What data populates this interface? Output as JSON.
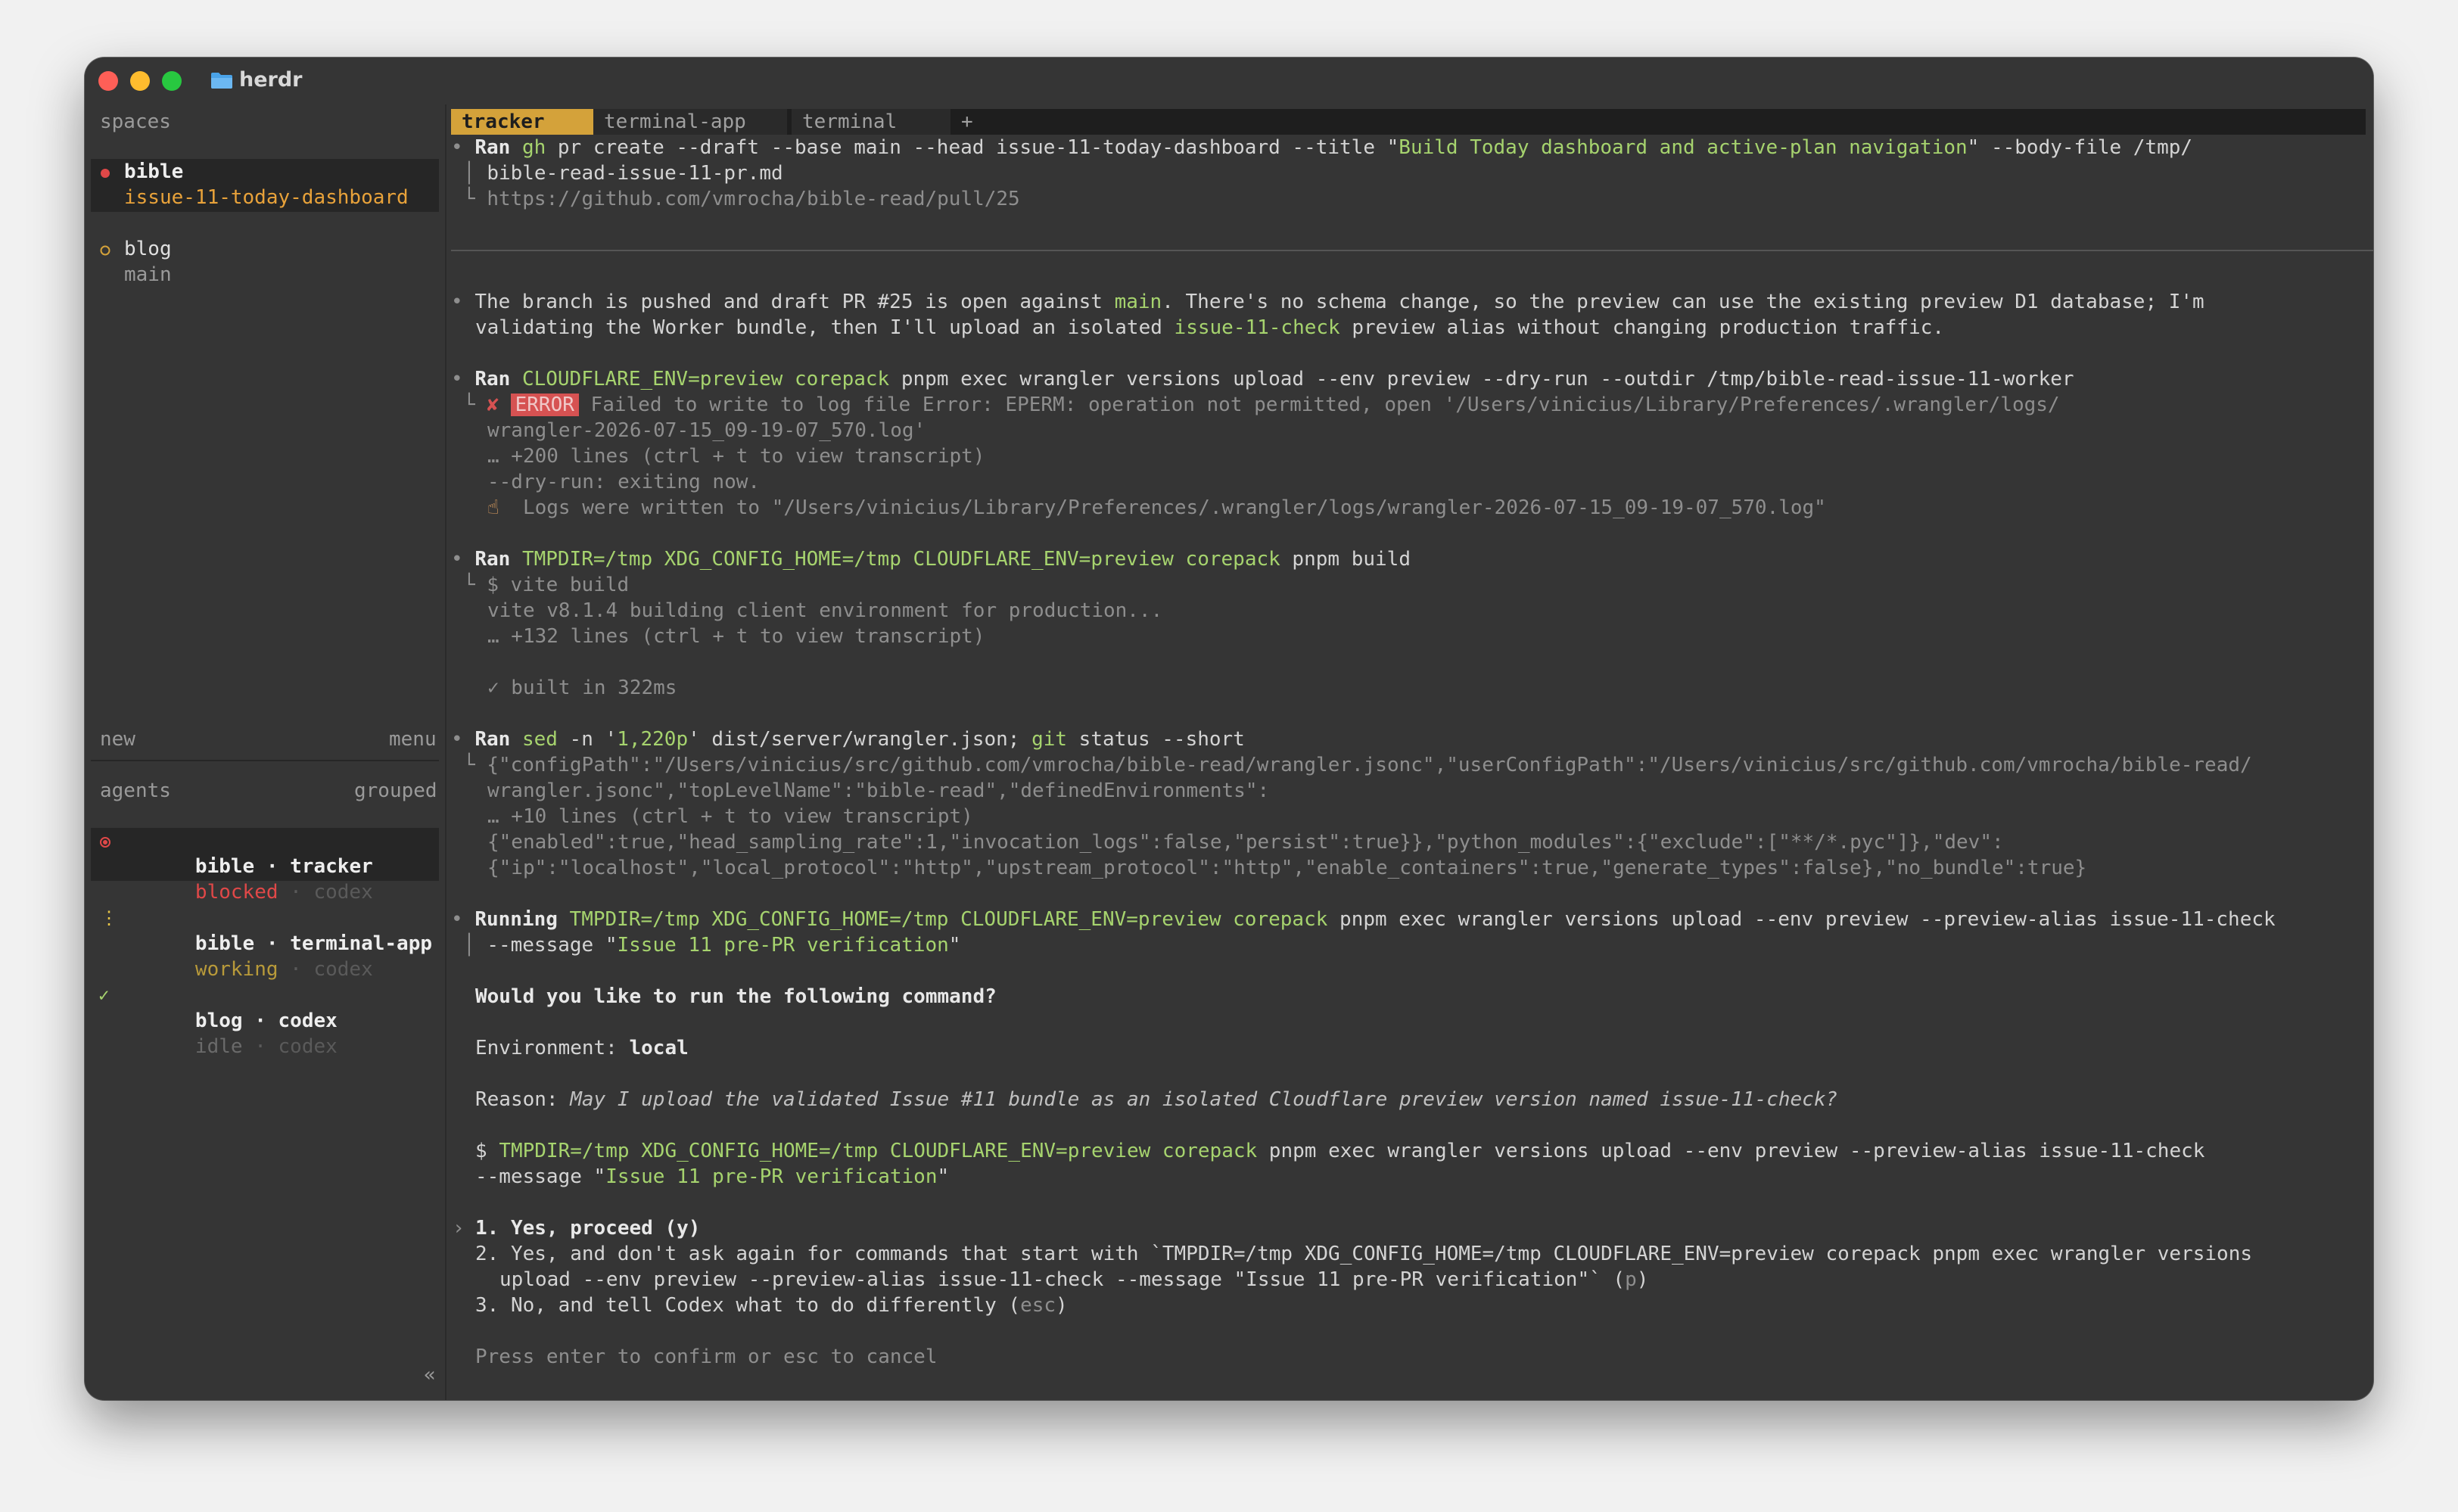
{
  "window": {
    "title": "herdr"
  },
  "sidebar": {
    "spaces_header": "spaces",
    "spaces": [
      {
        "name": "bible",
        "branch": "issue-11-today-dashboard",
        "status": "active"
      },
      {
        "name": "blog",
        "branch": "main",
        "status": "idle"
      }
    ],
    "new_label": "new",
    "menu_label": "menu",
    "agents_header": "agents",
    "grouped_label": "grouped",
    "agents": [
      {
        "space": "bible",
        "separator": " · ",
        "name": "tracker",
        "state": "blocked",
        "tool": "codex"
      },
      {
        "space": "bible",
        "separator": " · ",
        "name": "terminal-app",
        "state": "working",
        "tool": "codex"
      },
      {
        "space": "blog",
        "separator": " · ",
        "name": "codex",
        "state": "idle",
        "tool": "codex"
      }
    ],
    "collapse_label": "«"
  },
  "tabs": [
    {
      "label": "tracker",
      "active": true
    },
    {
      "label": "terminal-app",
      "active": false
    },
    {
      "label": "terminal",
      "active": false
    }
  ],
  "new_tab_label": "+",
  "transcript": {
    "pr": {
      "ran": "Ran",
      "tool": "gh",
      "cmd_a": " pr create --draft --base main --head issue-11-today-dashboard --title \"",
      "title_arg": "Build Today dashboard and active-plan navigation",
      "cmd_b": "\" --body-file /tmp/",
      "cont": "bible-read-issue-11-pr.md",
      "url": "https://github.com/vmrocha/bible-read/pull/25"
    },
    "note": {
      "line1_a": "The branch is pushed and draft PR #25 is open against ",
      "line1_b": "main",
      "line1_c": ". There's no schema change, so the preview can use the existing preview D1 database; I'm",
      "line2_a": "validating the Worker bundle, then I'll upload an isolated ",
      "line2_b": "issue-11-check",
      "line2_c": " preview alias without changing production traffic."
    },
    "dryrun": {
      "ran": "Ran",
      "env": "CLOUDFLARE_ENV=preview",
      "corepack": "corepack",
      "rest": " pnpm exec wrangler versions upload --env preview --dry-run --outdir /tmp/bible-read-issue-11-worker",
      "error_badge": "ERROR",
      "error_text": " Failed to write to log file Error: EPERM: operation not permitted, open '/Users/vinicius/Library/Preferences/.wrangler/logs/",
      "error_cont": "wrangler-2026-07-15_09-19-07_570.log'",
      "more": "… +200 lines (ctrl + t to view transcript)",
      "exiting": "--dry-run: exiting now.",
      "logs": "Logs were written to \"/Users/vinicius/Library/Preferences/.wrangler/logs/wrangler-2026-07-15_09-19-07_570.log\""
    },
    "build": {
      "ran": "Ran",
      "env1": "TMPDIR=/tmp",
      "env2": "XDG_CONFIG_HOME=/tmp",
      "env3": "CLOUDFLARE_ENV=preview",
      "corepack": "corepack",
      "rest": " pnpm build",
      "out1": "$ vite build",
      "out2": "vite v8.1.4 building client environment for production...",
      "out3": "… +132 lines (ctrl + t to view transcript)",
      "out4": "✓ built in 322ms"
    },
    "sed": {
      "ran": "Ran",
      "sed": "sed",
      "args_a": " -n '",
      "range": "1,220p",
      "args_b": "' dist/server/wrangler.json; ",
      "git": "git",
      "args_c": " status --short",
      "out1": "{\"configPath\":\"/Users/vinicius/src/github.com/vmrocha/bible-read/wrangler.jsonc\",\"userConfigPath\":\"/Users/vinicius/src/github.com/vmrocha/bible-read/",
      "out2": "wrangler.jsonc\",\"topLevelName\":\"bible-read\",\"definedEnvironments\":",
      "out3": "… +10 lines (ctrl + t to view transcript)",
      "out4": "{\"enabled\":true,\"head_sampling_rate\":1,\"invocation_logs\":false,\"persist\":true}},\"python_modules\":{\"exclude\":[\"**/*.pyc\"]},\"dev\":",
      "out5": "{\"ip\":\"localhost\",\"local_protocol\":\"http\",\"upstream_protocol\":\"http\",\"enable_containers\":true,\"generate_types\":false},\"no_bundle\":true}"
    },
    "running": {
      "label": "Running",
      "env1": "TMPDIR=/tmp",
      "env2": "XDG_CONFIG_HOME=/tmp",
      "env3": "CLOUDFLARE_ENV=preview",
      "corepack": "corepack",
      "rest": " pnpm exec wrangler versions upload --env preview --preview-alias issue-11-check",
      "cont_a": "--message \"",
      "message": "Issue 11 pre-PR verification",
      "cont_b": "\""
    }
  },
  "prompt": {
    "question": "Would you like to run the following command?",
    "env_label": "Environment: ",
    "env_value": "local",
    "reason_label": "Reason: ",
    "reason_text": "May I upload the validated Issue #11 bundle as an isolated Cloudflare preview version named issue-11-check?",
    "cmd_prefix": "$ ",
    "env1": "TMPDIR=/tmp",
    "env2": "XDG_CONFIG_HOME=/tmp",
    "env3": "CLOUDFLARE_ENV=preview",
    "corepack": "corepack",
    "cmd_rest": " pnpm exec wrangler versions upload --env preview --preview-alias issue-11-check",
    "cmd_cont_a": "--message \"",
    "cmd_msg": "Issue 11 pre-PR verification",
    "cmd_cont_b": "\"",
    "selector": "›",
    "option1": "1. Yes, proceed (y)",
    "option2_line1": "2. Yes, and don't ask again for commands that start with `TMPDIR=/tmp XDG_CONFIG_HOME=/tmp CLOUDFLARE_ENV=preview corepack pnpm exec wrangler versions",
    "option2_line2": "upload --env preview --preview-alias issue-11-check --message \"Issue 11 pre-PR verification\"` (",
    "option2_key": "p",
    "option2_close": ")",
    "option3": "3. No, and tell Codex what to do differently (",
    "option3_key": "esc",
    "option3_close": ")",
    "footer": "Press enter to confirm or esc to cancel"
  },
  "colors": {
    "accent_tab": "#d4a23a",
    "command_green": "#a6d36e",
    "error_red": "#d65252",
    "blocked_red": "#e04848",
    "working_yellow": "#e8c547"
  },
  "icons": [
    "folder-icon",
    "status-dot-icon",
    "status-ring-icon",
    "blocked-icon",
    "spinner-icon",
    "check-icon",
    "error-x-icon",
    "hand-icon"
  ]
}
